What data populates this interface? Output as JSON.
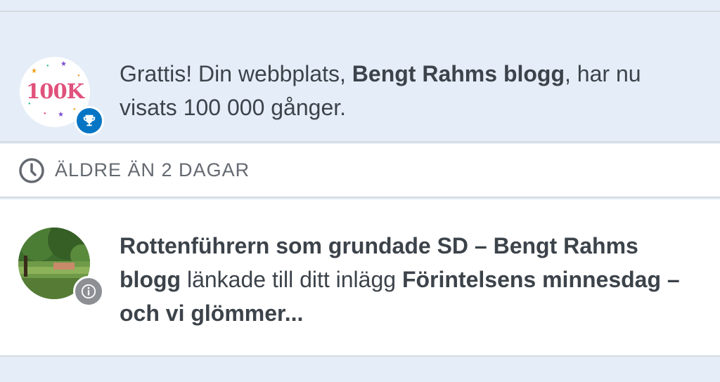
{
  "achievement": {
    "badge_text": "100K",
    "text_prefix": "Grattis! Din webbplats, ",
    "site_name": "Bengt Rahms blogg",
    "text_suffix": ", har nu visats 100 000 gånger."
  },
  "section": {
    "label": "ÄLDRE ÄN 2 DAGAR"
  },
  "pingback": {
    "source_title": "Rottenführern som grundade SD – Bengt Rahms blogg",
    "middle_text": " länkade till ditt inlägg ",
    "post_title": "Förintelsens minnesdag – och vi glömmer..."
  },
  "colors": {
    "unread_bg": "#e5eef8",
    "read_bg": "#ffffff",
    "trophy_blue": "#0675c4",
    "info_gray": "#8c8f94",
    "badge_pink": "#e0517c"
  },
  "icons": {
    "trophy": "trophy-icon",
    "clock": "clock-icon",
    "info": "info-icon"
  }
}
